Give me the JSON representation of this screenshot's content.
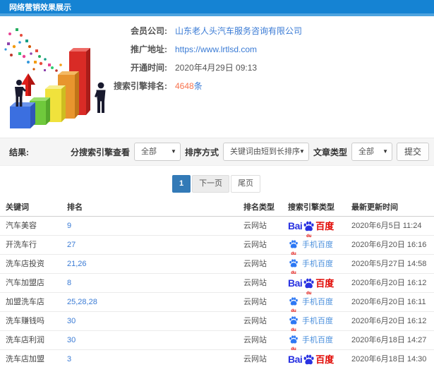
{
  "header": {
    "title": "网络营销效果展示"
  },
  "info": {
    "rows": [
      {
        "label": "会员公司:",
        "value": "山东老人头汽车服务咨询有限公司"
      },
      {
        "label": "推广地址:",
        "value": "https://www.lrtlsd.com"
      },
      {
        "label": "开通时间:",
        "value": "2020年4月29日 09:13"
      },
      {
        "label": "搜索引擎排名:",
        "value": "4648",
        "suffix": "条"
      }
    ]
  },
  "filters": {
    "result_label": "结果:",
    "engine_filter_label": "分搜索引擎查看",
    "engine_filter_value": "全部",
    "sort_label": "排序方式",
    "sort_value": "关键词由短到长排序",
    "article_type_label": "文章类型",
    "article_type_value": "全部",
    "submit_label": "提交",
    "caret": "▼"
  },
  "pagination": {
    "current": "1",
    "next": "下一页",
    "last": "尾页"
  },
  "table": {
    "columns": [
      "关键词",
      "排名",
      "排名类型",
      "搜索引擎类型",
      "最新更新时间"
    ],
    "rows": [
      {
        "keyword": "汽车美容",
        "rank": "9",
        "rank_type": "云网站",
        "engine": "baidu",
        "updated": "2020年6月5日 11:24"
      },
      {
        "keyword": "开洗车行",
        "rank": "27",
        "rank_type": "云网站",
        "engine": "mobile-baidu",
        "updated": "2020年6月20日 16:16"
      },
      {
        "keyword": "洗车店投资",
        "rank": "21,26",
        "rank_type": "云网站",
        "engine": "mobile-baidu",
        "updated": "2020年5月27日 14:58"
      },
      {
        "keyword": "汽车加盟店",
        "rank": "8",
        "rank_type": "云网站",
        "engine": "baidu",
        "updated": "2020年6月20日 16:12"
      },
      {
        "keyword": "加盟洗车店",
        "rank": "25,28,28",
        "rank_type": "云网站",
        "engine": "mobile-baidu",
        "updated": "2020年6月20日 16:11"
      },
      {
        "keyword": "洗车赚钱吗",
        "rank": "30",
        "rank_type": "云网站",
        "engine": "mobile-baidu",
        "updated": "2020年6月20日 16:12"
      },
      {
        "keyword": "洗车店利润",
        "rank": "30",
        "rank_type": "云网站",
        "engine": "mobile-baidu",
        "updated": "2020年6月18日 14:27"
      },
      {
        "keyword": "洗车店加盟",
        "rank": "3",
        "rank_type": "云网站",
        "engine": "baidu",
        "updated": "2020年6月18日 14:30"
      }
    ]
  },
  "logos": {
    "baidu": {
      "prefix": "Bai",
      "du": "du",
      "suffix": "百度"
    },
    "mobile_baidu": {
      "du": "du",
      "label": "手机百度"
    }
  },
  "colors": {
    "header_blue": "#1583d3",
    "link_blue": "#3a7bd5",
    "rank_orange": "#f8744f",
    "active_page_blue": "#337ab7",
    "baidu_blue": "#2932e1",
    "baidu_red": "#e10601",
    "mobile_baidu_blue": "#4a8fdc",
    "filterbar_gray": "#f5f5f5"
  }
}
